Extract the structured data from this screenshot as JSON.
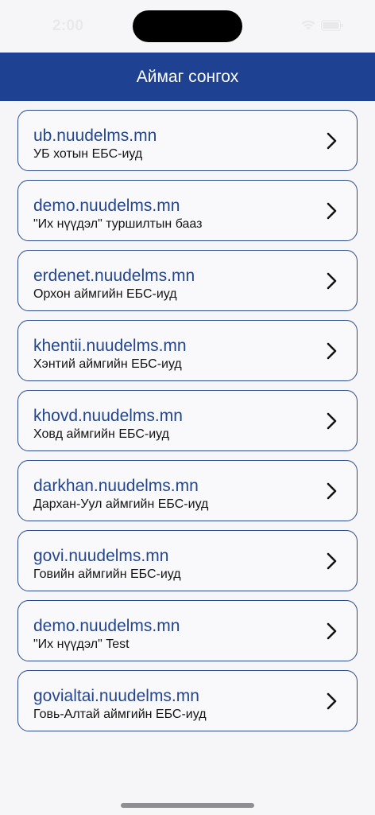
{
  "status_bar": {
    "time": "2:00",
    "icons": [
      "wifi-icon",
      "battery-icon"
    ]
  },
  "header": {
    "title": "Аймаг сонгох"
  },
  "servers": [
    {
      "domain": "ub.nuudelms.mn",
      "description": "УБ хотын ЕБС-иуд"
    },
    {
      "domain": "demo.nuudelms.mn",
      "description": "\"Их нүүдэл\" туршилтын бааз"
    },
    {
      "domain": "erdenet.nuudelms.mn",
      "description": "Орхон аймгийн ЕБС-иуд"
    },
    {
      "domain": "khentii.nuudelms.mn",
      "description": "Хэнтий аймгийн ЕБС-иуд"
    },
    {
      "domain": "khovd.nuudelms.mn",
      "description": "Ховд аймгийн ЕБС-иуд"
    },
    {
      "domain": "darkhan.nuudelms.mn",
      "description": "Дархан-Уул аймгийн ЕБС-иуд"
    },
    {
      "domain": "govi.nuudelms.mn",
      "description": "Говийн аймгийн ЕБС-иуд"
    },
    {
      "domain": "demo.nuudelms.mn",
      "description": "\"Их нүүдэл\" Test"
    },
    {
      "domain": "govialtai.nuudelms.mn",
      "description": "Говь-Алтай аймгийн ЕБС-иуд"
    }
  ],
  "colors": {
    "header_bg": "#1e4291",
    "accent_text": "#24468f",
    "card_border": "#2c4a8e",
    "background": "#f6f6f8"
  }
}
